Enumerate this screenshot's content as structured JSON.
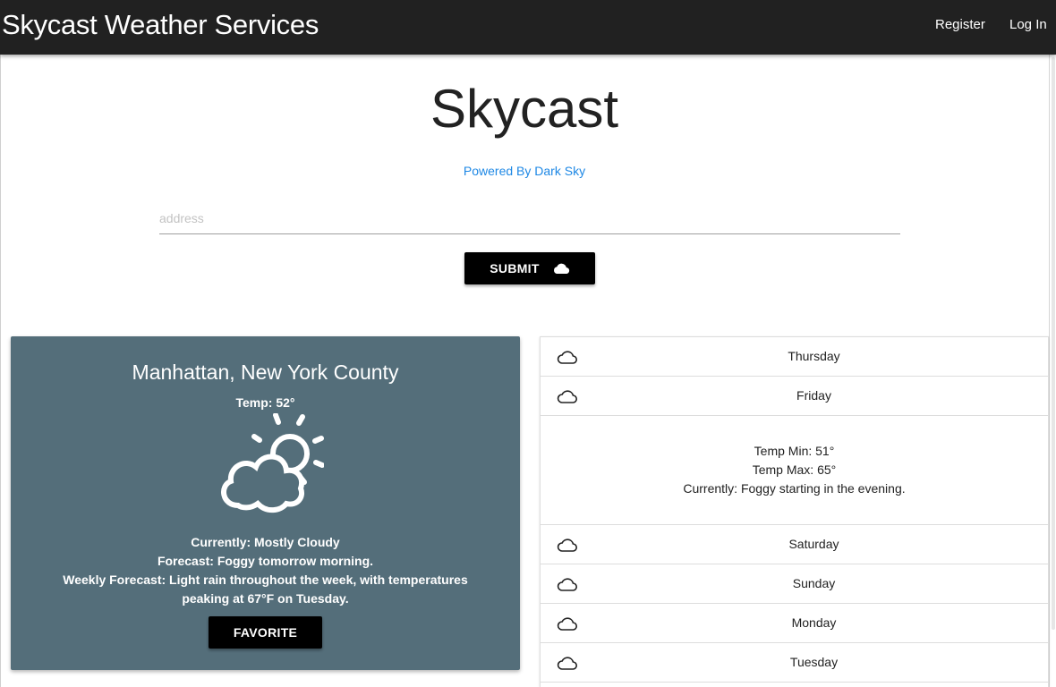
{
  "navbar": {
    "brand": "Skycast Weather Services",
    "register_label": "Register",
    "login_label": "Log In"
  },
  "hero": {
    "title": "Skycast",
    "powered_by": "Powered By Dark Sky"
  },
  "search": {
    "placeholder": "address",
    "value": "",
    "submit_label": "SUBMIT",
    "submit_icon": "cloud-icon"
  },
  "current": {
    "location": "Manhattan, New York County",
    "temp": "Temp: 52°",
    "icon": "partly-cloudy-day-icon",
    "currently": "Currently: Mostly Cloudy",
    "forecast": "Forecast: Foggy tomorrow morning.",
    "weekly": "Weekly Forecast: Light rain throughout the week, with temperatures peaking at 67°F on Tuesday.",
    "favorite_label": "FAVORITE"
  },
  "days": [
    {
      "name": "Thursday",
      "icon": "cloud-icon"
    },
    {
      "name": "Friday",
      "icon": "cloud-icon",
      "expanded": true,
      "temp_min": "Temp Min: 51°",
      "temp_max": "Temp Max: 65°",
      "currently": "Currently: Foggy starting in the evening."
    },
    {
      "name": "Saturday",
      "icon": "cloud-icon"
    },
    {
      "name": "Sunday",
      "icon": "cloud-icon"
    },
    {
      "name": "Monday",
      "icon": "cloud-icon"
    },
    {
      "name": "Tuesday",
      "icon": "cloud-icon"
    }
  ],
  "colors": {
    "navbar": "#212121",
    "card": "#546e7a",
    "link": "#1e88e5",
    "button": "#000000"
  }
}
